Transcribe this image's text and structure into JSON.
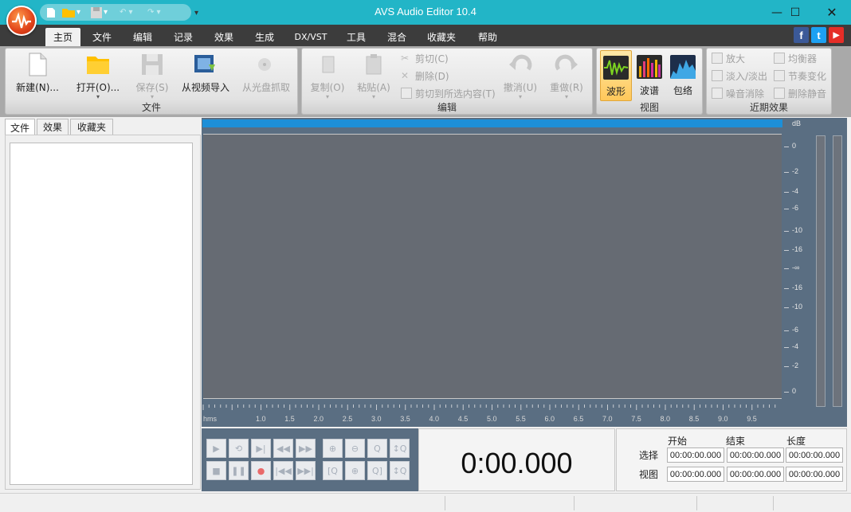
{
  "window": {
    "title": "AVS Audio Editor 10.4",
    "min_icon": "minimize-icon",
    "max_icon": "maximize-icon",
    "close_icon": "close-icon"
  },
  "menu_tabs": [
    "主页",
    "文件",
    "编辑",
    "记录",
    "效果",
    "生成",
    "DX/VST",
    "工具",
    "混合",
    "收藏夹",
    "帮助"
  ],
  "ribbon": {
    "file_group": {
      "label": "文件",
      "buttons": [
        "新建(N)...",
        "打开(O)...",
        "保存(S)",
        "从视频导入",
        "从光盘抓取"
      ]
    },
    "edit_group": {
      "label": "编辑",
      "copy": "复制(O)",
      "paste": "粘贴(A)",
      "cut": "剪切(C)",
      "delete": "删除(D)",
      "crop": "剪切到所选内容(T)",
      "undo": "撤消(U)",
      "redo": "重做(R)"
    },
    "view_group": {
      "label": "视图",
      "waveform": "波形",
      "spectrum": "波谱",
      "envelope": "包络"
    },
    "recent_group": {
      "label": "近期效果",
      "items": [
        "放大",
        "均衡器",
        "淡入/淡出",
        "节奏变化",
        "噪音消除",
        "删除静音"
      ]
    }
  },
  "left_panel": {
    "tabs": [
      "文件",
      "效果",
      "收藏夹"
    ]
  },
  "ruler": {
    "unit": "hms",
    "ticks": [
      "1.0",
      "1.5",
      "2.0",
      "2.5",
      "3.0",
      "3.5",
      "4.0",
      "4.5",
      "5.0",
      "5.5",
      "6.0",
      "6.5",
      "7.0",
      "7.5",
      "8.0",
      "8.5",
      "9.0",
      "9.5"
    ]
  },
  "db_scale": {
    "unit": "dB",
    "labels": [
      "0",
      "-2",
      "-4",
      "-6",
      "-10",
      "-16",
      "-∞",
      "-16",
      "-10",
      "-6",
      "-4",
      "-2",
      "0"
    ]
  },
  "time_display": "0:00.000",
  "selection": {
    "headers": [
      "开始",
      "结束",
      "长度"
    ],
    "rows": [
      {
        "label": "选择",
        "start": "00:00:00.000",
        "end": "00:00:00.000",
        "length": "00:00:00.000"
      },
      {
        "label": "视图",
        "start": "00:00:00.000",
        "end": "00:00:00.000",
        "length": "00:00:00.000"
      }
    ]
  }
}
